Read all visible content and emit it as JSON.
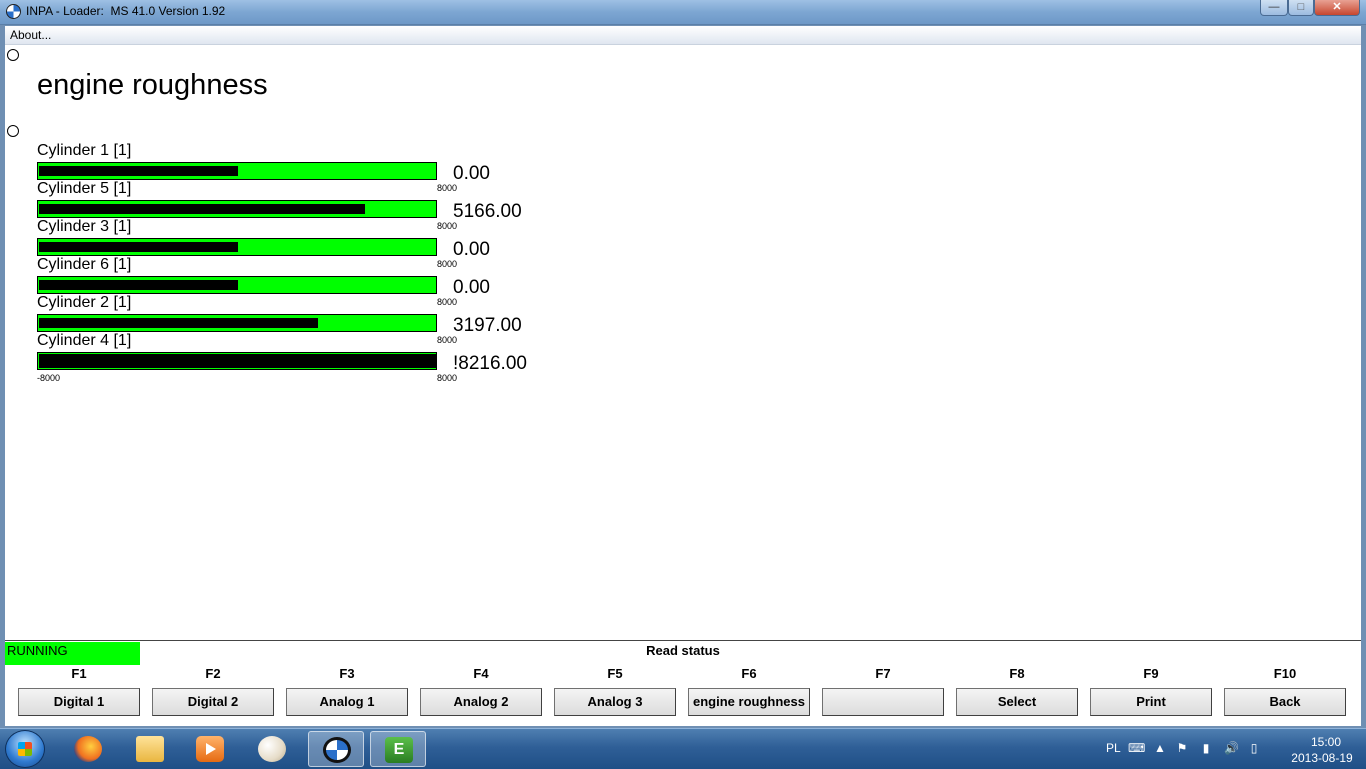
{
  "window": {
    "title": "INPA - Loader:  MS 41.0 Version 1.92",
    "minimize": "—",
    "maximize": "□",
    "close": "✕"
  },
  "menu": {
    "about": "About..."
  },
  "screen": {
    "title": "engine roughness",
    "cylinders": [
      {
        "label": "Cylinder 1 [1]",
        "value": "0.00",
        "max": "8000",
        "level": 0.5
      },
      {
        "label": "Cylinder 5 [1]",
        "value": "5166.00",
        "max": "8000",
        "level": 0.82
      },
      {
        "label": "Cylinder 3 [1]",
        "value": "0.00",
        "max": "8000",
        "level": 0.5
      },
      {
        "label": "Cylinder 6 [1]",
        "value": "0.00",
        "max": "8000",
        "level": 0.5
      },
      {
        "label": "Cylinder 2 [1]",
        "value": "3197.00",
        "max": "8000",
        "level": 0.7
      },
      {
        "label": "Cylinder 4 [1]",
        "value": "!8216.00",
        "min": "-8000",
        "max": "8000",
        "level": 1.0
      }
    ]
  },
  "status": {
    "running": "RUNNING",
    "read_status": "Read status"
  },
  "fkeys": [
    {
      "key": "F1",
      "label": "Digital 1"
    },
    {
      "key": "F2",
      "label": "Digital 2"
    },
    {
      "key": "F3",
      "label": "Analog 1"
    },
    {
      "key": "F4",
      "label": "Analog 2"
    },
    {
      "key": "F5",
      "label": "Analog 3"
    },
    {
      "key": "F6",
      "label": "engine roughness"
    },
    {
      "key": "F7",
      "label": ""
    },
    {
      "key": "F8",
      "label": "Select"
    },
    {
      "key": "F9",
      "label": "Print"
    },
    {
      "key": "F10",
      "label": "Back"
    }
  ],
  "taskbar": {
    "ediabas_letter": "E",
    "tray": {
      "language": "PL",
      "time": "15:00",
      "date": "2013-08-19"
    }
  }
}
